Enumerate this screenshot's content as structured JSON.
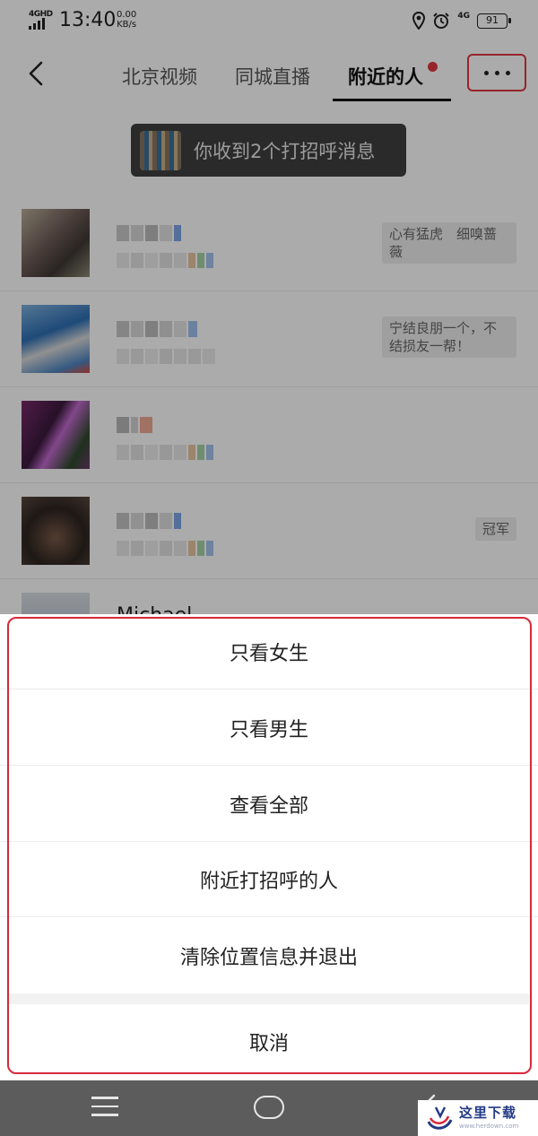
{
  "status_bar": {
    "network_left": "4GHD",
    "time": "13:40",
    "speed_value": "0.00",
    "speed_unit": "KB/s",
    "network_right": "4G",
    "battery": "91"
  },
  "header": {
    "tabs": [
      {
        "label": "北京视频",
        "active": false
      },
      {
        "label": "同城直播",
        "active": false
      },
      {
        "label": "附近的人",
        "active": true
      }
    ],
    "accent_color": "#e0383e"
  },
  "banner": {
    "text": "你收到2个打招呼消息"
  },
  "list": {
    "items": [
      {
        "tag": "心有猛虎　细嗅蔷薇"
      },
      {
        "tag": "宁结良朋一个，不结损友一帮！"
      },
      {
        "tag": ""
      },
      {
        "tag": "冠军"
      },
      {
        "name": "Michael"
      }
    ]
  },
  "action_sheet": {
    "options": [
      "只看女生",
      "只看男生",
      "查看全部",
      "附近打招呼的人",
      "清除位置信息并退出"
    ],
    "cancel": "取消",
    "highlight_color": "#d8293a"
  },
  "watermark": {
    "text": "这里下载",
    "url": "www.herdown.com"
  }
}
